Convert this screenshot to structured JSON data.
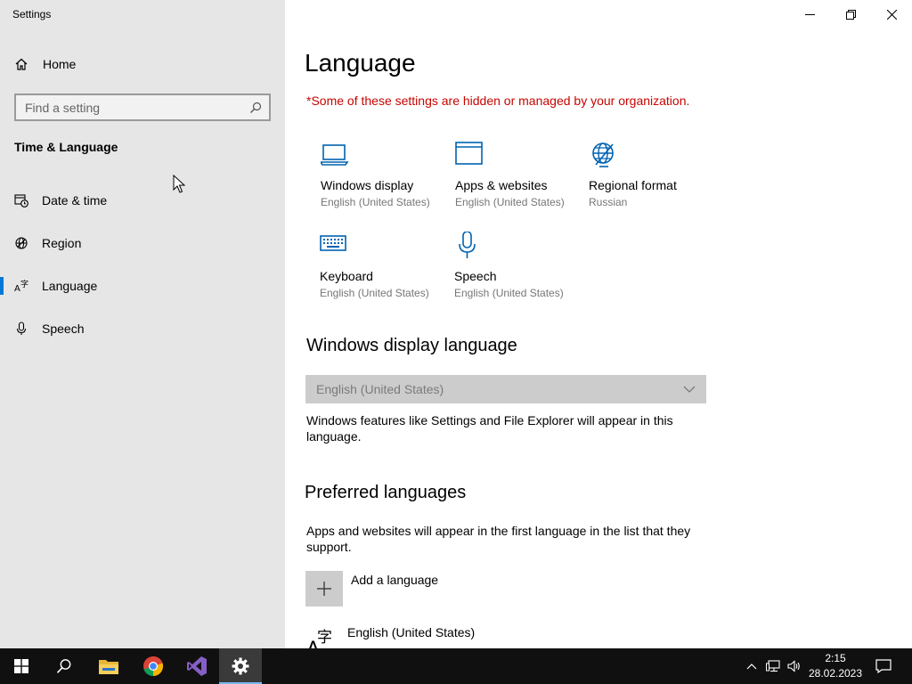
{
  "window": {
    "title": "Settings"
  },
  "sidebar": {
    "home_label": "Home",
    "search_placeholder": "Find a setting",
    "section_title": "Time & Language",
    "items": [
      {
        "label": "Date & time"
      },
      {
        "label": "Region"
      },
      {
        "label": "Language",
        "selected": true
      },
      {
        "label": "Speech"
      }
    ]
  },
  "main": {
    "title": "Language",
    "warning": "*Some of these settings are hidden or managed by your organization.",
    "tiles": [
      {
        "icon": "laptop-icon",
        "name": "Windows display",
        "sub": "English (United States)"
      },
      {
        "icon": "browser-window-icon",
        "name": "Apps & websites",
        "sub": "English (United States)"
      },
      {
        "icon": "globe-icon",
        "name": "Regional format",
        "sub": "Russian"
      },
      {
        "icon": "keyboard-icon",
        "name": "Keyboard",
        "sub": "English (United States)"
      },
      {
        "icon": "microphone-icon",
        "name": "Speech",
        "sub": "English (United States)"
      }
    ],
    "display_language": {
      "heading": "Windows display language",
      "selected": "English (United States)",
      "description": "Windows features like Settings and File Explorer will appear in this language."
    },
    "preferred": {
      "heading": "Preferred languages",
      "description": "Apps and websites will appear in the first language in the list that they support.",
      "add_label": "Add a language",
      "languages": [
        "English (United States)"
      ]
    }
  },
  "taskbar": {
    "apps": [
      "start",
      "search",
      "file-explorer",
      "chrome",
      "visual-studio",
      "settings"
    ],
    "active_app": "settings",
    "time": "2:15",
    "date": "28.02.2023"
  },
  "colors": {
    "accent": "#0078d7",
    "warning": "#c50500",
    "sidebar_bg": "#e6e6e6"
  }
}
